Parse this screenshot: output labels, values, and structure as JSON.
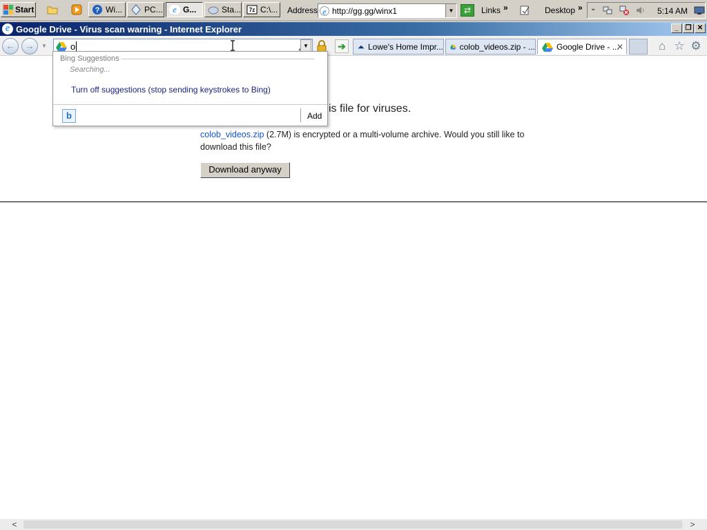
{
  "taskbar": {
    "start_label": "Start",
    "tasks": [
      {
        "label": "Wi...",
        "icon": "help-icon"
      },
      {
        "label": "PC...",
        "icon": "pc-icon"
      },
      {
        "label": "G...",
        "icon": "ie-icon",
        "active": true
      },
      {
        "label": "Sta...",
        "icon": "app-icon"
      },
      {
        "label": "C:\\...",
        "icon": "7zip-icon"
      }
    ],
    "address_label": "Address",
    "address_value": "http://gg.gg/winx1",
    "links_label": "Links",
    "desktop_label": "Desktop",
    "clock": "5:14 AM",
    "more_chevron": "»"
  },
  "window": {
    "title": "Google Drive - Virus scan warning - Internet Explorer",
    "controls": {
      "minimize": "_",
      "restore": "❐",
      "close": "✕"
    }
  },
  "navbar": {
    "url_value": "o",
    "tabs": [
      {
        "label": "Lowe's Home Impr...",
        "icon": "lowes-icon"
      },
      {
        "label": "colob_videos.zip - ...",
        "icon": "google-drive-icon"
      },
      {
        "label": "Google Drive - ...",
        "icon": "google-drive-icon",
        "active": true,
        "close": "✕"
      }
    ]
  },
  "suggestions": {
    "header": "Bing Suggestions",
    "status": "Searching...",
    "turn_off": "Turn off suggestions (stop sending keystrokes to Bing)",
    "add_label": "Add",
    "provider_icon": "b"
  },
  "page": {
    "heading_visible": "is file for viruses.",
    "file_link": "colob_videos.zip",
    "file_size": "(2.7M)",
    "message_rest": "is encrypted or a multi-volume archive. Would you still like to download this file?",
    "download_button": "Download anyway"
  },
  "colors": {
    "titlebar": "#0a246a",
    "link": "#1155cc",
    "suggestion_link": "#1a237e"
  }
}
